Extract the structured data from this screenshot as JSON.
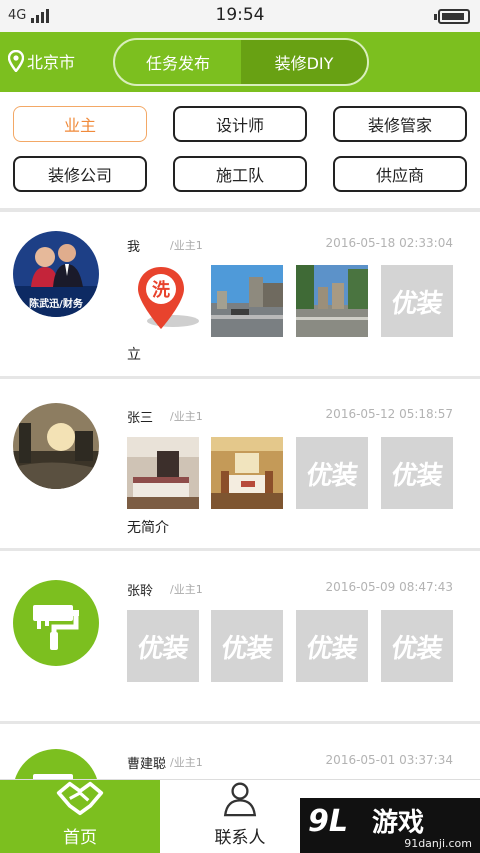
{
  "status_bar": {
    "network": "4G",
    "time": "19:54"
  },
  "header": {
    "city": "北京市",
    "tabs": [
      {
        "label": "任务发布",
        "active": false
      },
      {
        "label": "装修DIY",
        "active": true
      }
    ]
  },
  "roles": [
    {
      "label": "业主",
      "active": true
    },
    {
      "label": "设计师",
      "active": false
    },
    {
      "label": "装修管家",
      "active": false
    },
    {
      "label": "装修公司",
      "active": false
    },
    {
      "label": "施工队",
      "active": false
    },
    {
      "label": "供应商",
      "active": false
    }
  ],
  "placeholder_text": "优装",
  "wash_icon_text": "洗",
  "avatar1_caption": "陈武迅/财务",
  "posts": [
    {
      "name": "我",
      "role": "/业主1",
      "time": "2016-05-18 02:33:04",
      "desc": "立"
    },
    {
      "name": "张三",
      "role": "/业主1",
      "time": "2016-05-12 05:18:57",
      "desc": "无简介"
    },
    {
      "name": "张聆",
      "role": "/业主1",
      "time": "2016-05-09 08:47:43",
      "desc": ""
    },
    {
      "name": "曹建聪",
      "role": "/业主1",
      "time": "2016-05-01 03:37:34",
      "desc": ""
    }
  ],
  "bottom_nav": [
    {
      "label": "首页",
      "active": true
    },
    {
      "label": "联系人",
      "active": false
    }
  ],
  "watermark": {
    "main": "游戏",
    "logo": "9L",
    "sub": "91danji.com"
  },
  "colors": {
    "brand_green": "#7cbf1f",
    "active_orange": "#f08a3a",
    "placeholder_gray": "#d4d4d4"
  }
}
